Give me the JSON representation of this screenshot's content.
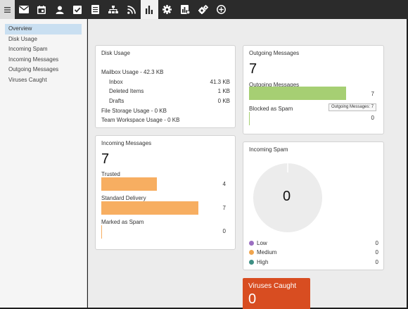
{
  "toolbar": {
    "items": [
      {
        "icon": "hamburger-menu-icon"
      },
      {
        "icon": "mail-icon"
      },
      {
        "icon": "calendar-icon"
      },
      {
        "icon": "user-icon"
      },
      {
        "icon": "checkbox-icon"
      },
      {
        "icon": "notes-icon"
      },
      {
        "icon": "org-chart-icon"
      },
      {
        "icon": "rss-icon"
      },
      {
        "icon": "bar-chart-icon",
        "active": true
      },
      {
        "icon": "gear-icon"
      },
      {
        "icon": "reports-icon"
      },
      {
        "icon": "gears-icon"
      },
      {
        "icon": "add-circle-icon"
      }
    ]
  },
  "sidebar": {
    "items": [
      {
        "label": "Overview",
        "active": true
      },
      {
        "label": "Disk Usage"
      },
      {
        "label": "Incoming Spam"
      },
      {
        "label": "Incoming Messages"
      },
      {
        "label": "Outgoing Messages"
      },
      {
        "label": "Viruses Caught"
      }
    ]
  },
  "disk_usage": {
    "title": "Disk Usage",
    "mailbox_label": "Mailbox Usage - 42.3 KB",
    "inbox_label": "Inbox",
    "inbox_value": "41.3 KB",
    "deleted_label": "Deleted Items",
    "deleted_value": "1 KB",
    "drafts_label": "Drafts",
    "drafts_value": "0 KB",
    "file_storage_label": "File Storage Usage - 0 KB",
    "team_workspace_label": "Team Workspace Usage - 0 KB"
  },
  "outgoing": {
    "title": "Outgoing Messages",
    "total": "7",
    "bars": [
      {
        "label": "Outgoing Messages",
        "value": "7",
        "fraction": 1.0,
        "color": "#a6cf73"
      },
      {
        "label": "Blocked as Spam",
        "value": "0",
        "fraction": 0.0,
        "color": "#a6cf73"
      }
    ],
    "tooltip": "Outgoing Messages: 7"
  },
  "incoming": {
    "title": "Incoming Messages",
    "total": "7",
    "bars": [
      {
        "label": "Trusted",
        "value": "4",
        "fraction": 0.5714,
        "color": "#f7ae61"
      },
      {
        "label": "Standard Delivery",
        "value": "7",
        "fraction": 1.0,
        "color": "#f7ae61"
      },
      {
        "label": "Marked as Spam",
        "value": "0",
        "fraction": 0.0,
        "color": "#f7ae61"
      }
    ]
  },
  "spam": {
    "title": "Incoming Spam",
    "total": "0",
    "legend": [
      {
        "label": "Low",
        "value": "0",
        "color": "#9b6fc1"
      },
      {
        "label": "Medium",
        "value": "0",
        "color": "#f0a54e"
      },
      {
        "label": "High",
        "value": "0",
        "color": "#3f8f84"
      }
    ]
  },
  "viruses": {
    "title": "Viruses Caught",
    "total": "0",
    "color": "#d84d21"
  }
}
